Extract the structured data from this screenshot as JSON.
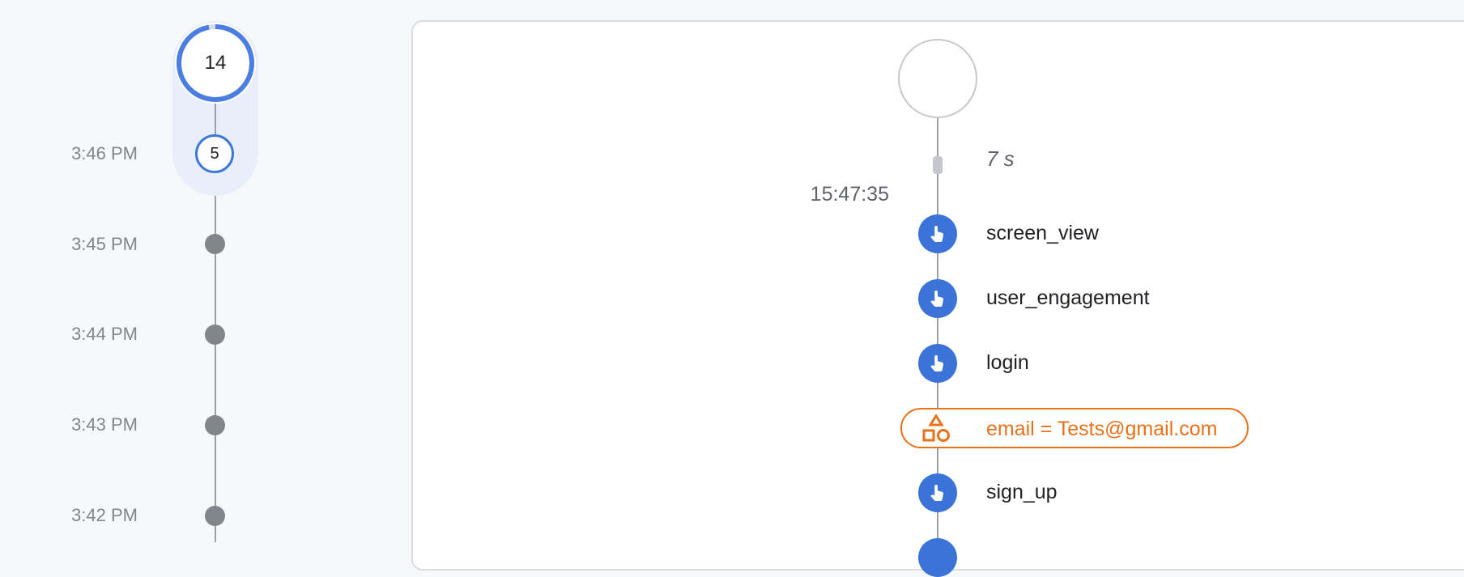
{
  "minute_timeline": {
    "selected_minute": {
      "event_count": "14",
      "session_count": "5",
      "time": "3:46 PM",
      "progress_fraction": 0.97
    },
    "minutes": [
      {
        "time": "3:45 PM"
      },
      {
        "time": "3:44 PM"
      },
      {
        "time": "3:43 PM"
      },
      {
        "time": "3:42 PM"
      }
    ]
  },
  "session_panel": {
    "gap_label": "7 s",
    "timestamp": "15:47:35",
    "events": [
      {
        "name": "screen_view",
        "icon": "touch-icon"
      },
      {
        "name": "user_engagement",
        "icon": "touch-icon"
      },
      {
        "name": "login",
        "icon": "touch-icon"
      },
      {
        "name": "email = Tests@gmail.com",
        "icon": "user-property-icon",
        "type": "user_property"
      },
      {
        "name": "sign_up",
        "icon": "touch-icon"
      }
    ]
  },
  "colors": {
    "accent_blue": "#3b73d9",
    "property_orange": "#e8711a",
    "muted_gray": "#80868b"
  }
}
